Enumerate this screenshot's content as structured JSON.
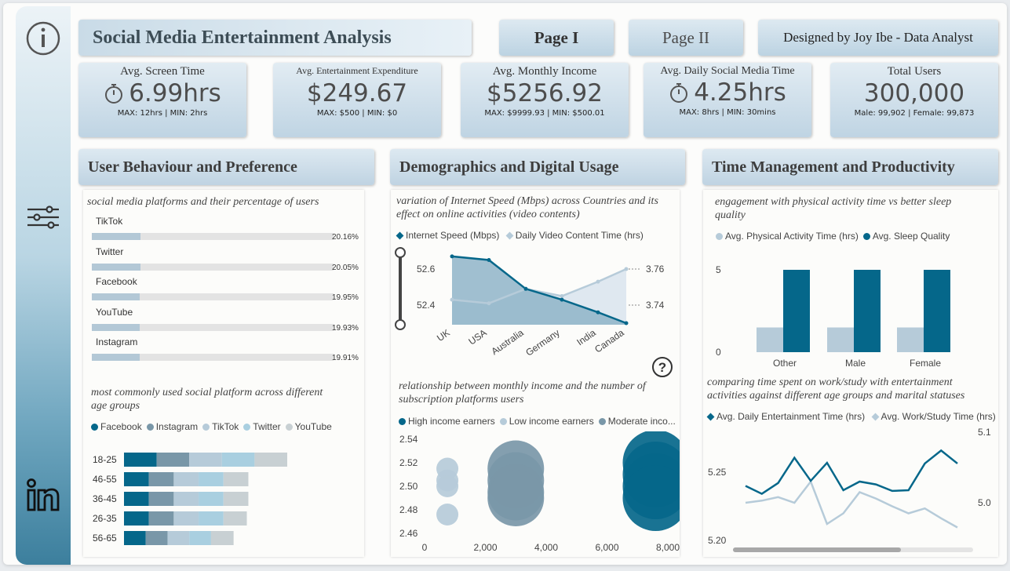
{
  "header": {
    "title": "Social Media Entertainment Analysis",
    "page1": "Page I",
    "page2": "Page II",
    "designer": "Designed by Joy Ibe - Data Analyst"
  },
  "sidebar": {
    "info_icon": "info-icon",
    "filter_icon": "filter-sliders-icon",
    "linkedin_icon": "linkedin-icon"
  },
  "kpis": [
    {
      "title": "Avg. Screen Time",
      "value": "6.99hrs",
      "sub": "MAX: 12hrs  | MIN: 2hrs",
      "icon": "stopwatch-icon"
    },
    {
      "title": "Avg. Entertainment Expenditure",
      "value": "$249.67",
      "sub": "MAX: $500 | MIN: $0"
    },
    {
      "title": "Avg. Monthly Income",
      "value": "$5256.92",
      "sub": "MAX: $9999.93 | MIN: $500.01"
    },
    {
      "title": "Avg. Daily Social Media Time",
      "value": "4.25hrs",
      "sub": "MAX: 8hrs  | MIN: 30mins",
      "icon": "stopwatch-icon"
    },
    {
      "title": "Total Users",
      "value": "300,000",
      "sub": "Male: 99,902 | Female: 99,873"
    }
  ],
  "sections": {
    "s1": "User Behaviour and Preference",
    "s2": "Demographics and Digital Usage",
    "s3": "Time Management and Productivity"
  },
  "colors": {
    "dark": "#05678a",
    "mid": "#7997a8",
    "light": "#b6cbd9",
    "lighter": "#a9cfe0",
    "grey": "#c8d0d3"
  },
  "chart_data": [
    {
      "type": "bar",
      "title": "social media platforms and their percentage of users",
      "categories": [
        "TikTok",
        "Twitter",
        "Facebook",
        "YouTube",
        "Instagram"
      ],
      "values": [
        20.16,
        20.05,
        19.95,
        19.93,
        19.91
      ],
      "labels": [
        "20.16%",
        "20.05%",
        "19.95%",
        "19.93%",
        "19.91%"
      ]
    },
    {
      "type": "bar",
      "title": "most commonly used social platform across different age groups",
      "legend": [
        "Facebook",
        "Instagram",
        "TikTok",
        "Twitter",
        "YouTube"
      ],
      "categories": [
        "18-25",
        "46-55",
        "36-45",
        "26-35",
        "56-65"
      ],
      "series": [
        {
          "name": "Facebook",
          "values": [
            21000,
            16000,
            16000,
            16000,
            14000
          ]
        },
        {
          "name": "Instagram",
          "values": [
            21000,
            16000,
            16000,
            16000,
            14000
          ]
        },
        {
          "name": "TikTok",
          "values": [
            21000,
            16000,
            16000,
            16000,
            14000
          ]
        },
        {
          "name": "Twitter",
          "values": [
            21000,
            16000,
            16000,
            16000,
            14000
          ]
        },
        {
          "name": "YouTube",
          "values": [
            21000,
            16000,
            16000,
            15000,
            14500
          ]
        }
      ]
    },
    {
      "type": "area",
      "title": "variation of Internet Speed (Mbps) across Countries and its effect on online activities (video contents)",
      "categories": [
        "UK",
        "USA",
        "Australia",
        "Germany",
        "India",
        "Canada"
      ],
      "series": [
        {
          "name": "Internet Speed (Mbps)",
          "values": [
            52.67,
            52.65,
            52.49,
            52.43,
            52.36,
            52.3
          ]
        },
        {
          "name": "Daily Video Content Time (hrs)",
          "values": [
            3.743,
            3.741,
            3.749,
            3.745,
            3.753,
            3.76
          ]
        }
      ],
      "yticks_left": [
        "52.6",
        "52.4"
      ],
      "yticks_right": [
        "3.76",
        "3.74"
      ]
    },
    {
      "type": "scatter",
      "title": "relationship between monthly income and the number of subscription platforms users",
      "legend": [
        "High income earners",
        "Low income earners",
        "Moderate inco..."
      ],
      "xticks": [
        "0",
        "2,000",
        "4,000",
        "6,000",
        "8,000"
      ],
      "yticks": [
        "2.54",
        "2.52",
        "2.50",
        "2.48",
        "2.46"
      ],
      "xlim": [
        0,
        8000
      ],
      "ylim": [
        2.46,
        2.54
      ],
      "points": [
        {
          "group": "Low income earners",
          "x": 750,
          "y": 2.515
        },
        {
          "group": "Low income earners",
          "x": 750,
          "y": 2.505
        },
        {
          "group": "Low income earners",
          "x": 750,
          "y": 2.5
        },
        {
          "group": "Low income earners",
          "x": 750,
          "y": 2.476
        },
        {
          "group": "Moderate inco...",
          "x": 3000,
          "y": 2.515
        },
        {
          "group": "Moderate inco...",
          "x": 3000,
          "y": 2.505
        },
        {
          "group": "Moderate inco...",
          "x": 3000,
          "y": 2.495
        },
        {
          "group": "Moderate inco...",
          "x": 3000,
          "y": 2.49
        },
        {
          "group": "High income earners",
          "x": 7600,
          "y": 2.52
        },
        {
          "group": "High income earners",
          "x": 7600,
          "y": 2.51
        },
        {
          "group": "High income earners",
          "x": 7600,
          "y": 2.5
        },
        {
          "group": "High income earners",
          "x": 7600,
          "y": 2.49
        }
      ]
    },
    {
      "type": "bar",
      "title": "engagement with physical activity time vs better sleep quality",
      "legend": [
        "Avg. Physical Activity Time (hrs)",
        "Avg. Sleep Quality"
      ],
      "categories": [
        "Other",
        "Male",
        "Female"
      ],
      "series": [
        {
          "name": "Avg. Physical Activity Time (hrs)",
          "values": [
            1.5,
            1.5,
            1.5
          ]
        },
        {
          "name": "Avg. Sleep Quality",
          "values": [
            5.0,
            5.0,
            5.0
          ]
        }
      ],
      "yticks": [
        "5",
        "0"
      ],
      "ylim": [
        0,
        5.8
      ]
    },
    {
      "type": "line",
      "title": "comparing time spent on work/study with entertainment activities against different age groups and marital statuses",
      "legend": [
        "Avg. Daily Entertainment Time (hrs)",
        "Avg. Work/Study Time (hrs)"
      ],
      "yticks_left": [
        "5.25",
        "5.20"
      ],
      "yticks_right": [
        "5.1",
        "5.0"
      ],
      "series": [
        {
          "name": "Avg. Daily Entertainment Time (hrs)",
          "values": [
            5.231,
            5.22,
            5.235,
            5.27,
            5.238,
            5.263,
            5.225,
            5.237,
            5.233,
            5.224,
            5.225,
            5.262,
            5.28,
            5.262
          ]
        },
        {
          "name": "Avg. Work/Study Time (hrs)",
          "values": [
            5.0,
            5.003,
            5.008,
            5.0,
            5.03,
            4.97,
            4.985,
            5.015,
            5.006,
            4.995,
            4.985,
            4.992,
            4.978,
            4.965
          ]
        }
      ]
    }
  ]
}
